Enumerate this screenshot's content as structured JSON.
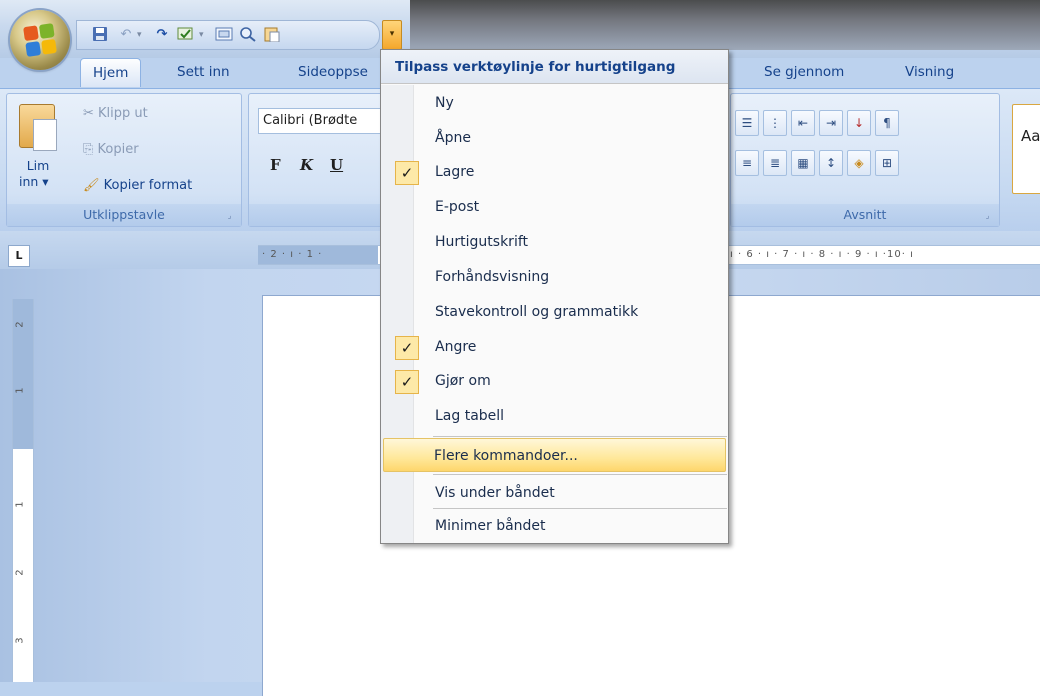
{
  "quick_access": {
    "dropdown_menu": {
      "title": "Tilpass verktøylinje for hurtigtilgang",
      "items": [
        {
          "label": "Ny",
          "checked": false
        },
        {
          "label": "Åpne",
          "checked": false
        },
        {
          "label": "Lagre",
          "checked": true
        },
        {
          "label": "E-post",
          "checked": false
        },
        {
          "label": "Hurtigutskrift",
          "checked": false
        },
        {
          "label": "Forhåndsvisning",
          "checked": false
        },
        {
          "label": "Stavekontroll og grammatikk",
          "checked": false
        },
        {
          "label": "Angre",
          "checked": true
        },
        {
          "label": "Gjør om",
          "checked": true
        },
        {
          "label": "Lag tabell",
          "checked": false
        },
        {
          "label": "Flere kommandoer...",
          "checked": false,
          "highlighted": true
        },
        {
          "label": "Vis under båndet",
          "checked": false
        },
        {
          "label": "Minimer båndet",
          "checked": false
        }
      ],
      "check_glyph": "✓"
    },
    "icons": [
      "save-icon",
      "undo-icon",
      "redo-icon",
      "spelling-icon",
      "window-icon",
      "preview-icon",
      "paste-icon"
    ]
  },
  "tabs": [
    {
      "label": "Hjem",
      "active": true
    },
    {
      "label": "Sett inn"
    },
    {
      "label": "Sideoppse"
    },
    {
      "label": "Se gjennom"
    },
    {
      "label": "Visning"
    }
  ],
  "ribbon": {
    "clipboard": {
      "label": "Utklippstavle",
      "paste_line1": "Lim",
      "paste_line2": "inn ▾",
      "cut": "Klipp ut",
      "copy": "Kopier",
      "format_painter": "Kopier format"
    },
    "font": {
      "font_name": "Calibri (Brødte",
      "bold": "F",
      "italic": "K",
      "underline": "U"
    },
    "paragraph": {
      "label": "Avsnitt"
    },
    "styles": {
      "sample": "Aa"
    }
  },
  "ruler": {
    "tab_selector": "L",
    "horizontal_text": "· 2 · ı · 1 ·",
    "horizontal_text_right": "ı · 6 · ı · 7 · ı · 8 · ı · 9 · ı ·10· ı",
    "vertical_numbers": [
      "2",
      "1",
      "1",
      "2",
      "3"
    ]
  },
  "colors": {
    "accent": "#15428b",
    "highlight": "#ffe89a",
    "check_bg": "#fde9a8"
  }
}
